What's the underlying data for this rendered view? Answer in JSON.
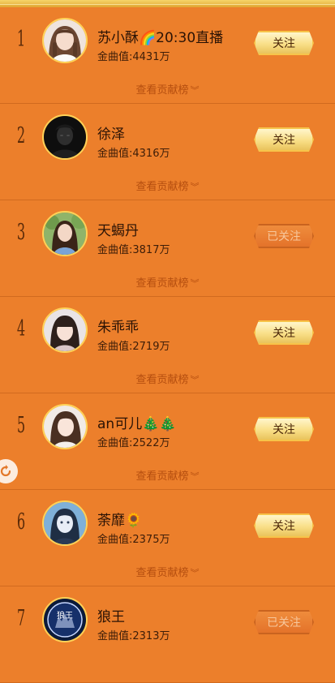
{
  "contrib_label": "查看贡献榜",
  "ranking": [
    {
      "rank": "1",
      "name": "苏小酥🌈20:30直播",
      "value_label": "金曲值:4431万",
      "button": "关注",
      "followed": false,
      "avatar": "avatar-girl-braids"
    },
    {
      "rank": "2",
      "name": "徐泽",
      "value_label": "金曲值:4316万",
      "button": "关注",
      "followed": false,
      "avatar": "avatar-dark-portrait"
    },
    {
      "rank": "3",
      "name": "天蝎丹",
      "value_label": "金曲值:3817万",
      "button": "已关注",
      "followed": true,
      "avatar": "avatar-girl-outdoor"
    },
    {
      "rank": "4",
      "name": "朱乖乖",
      "value_label": "金曲值:2719万",
      "button": "关注",
      "followed": false,
      "avatar": "avatar-girl-bangs"
    },
    {
      "rank": "5",
      "name": "an可儿🎄🎄",
      "value_label": "金曲值:2522万",
      "button": "关注",
      "followed": false,
      "avatar": "avatar-girl-long-hair"
    },
    {
      "rank": "6",
      "name": "荼靡🌻",
      "value_label": "金曲值:2375万",
      "button": "关注",
      "followed": false,
      "avatar": "avatar-girl-blue-tone"
    },
    {
      "rank": "7",
      "name": "狼王",
      "value_label": "金曲值:2313万",
      "button": "已关注",
      "followed": true,
      "avatar": "avatar-wolf-king-logo",
      "avatar_text": "狼王"
    }
  ],
  "colors": {
    "background": "#ec7f2b",
    "follow_button": "#f9df88",
    "followed_button": "#e4732a",
    "avatar_ring": "#ffd257"
  }
}
